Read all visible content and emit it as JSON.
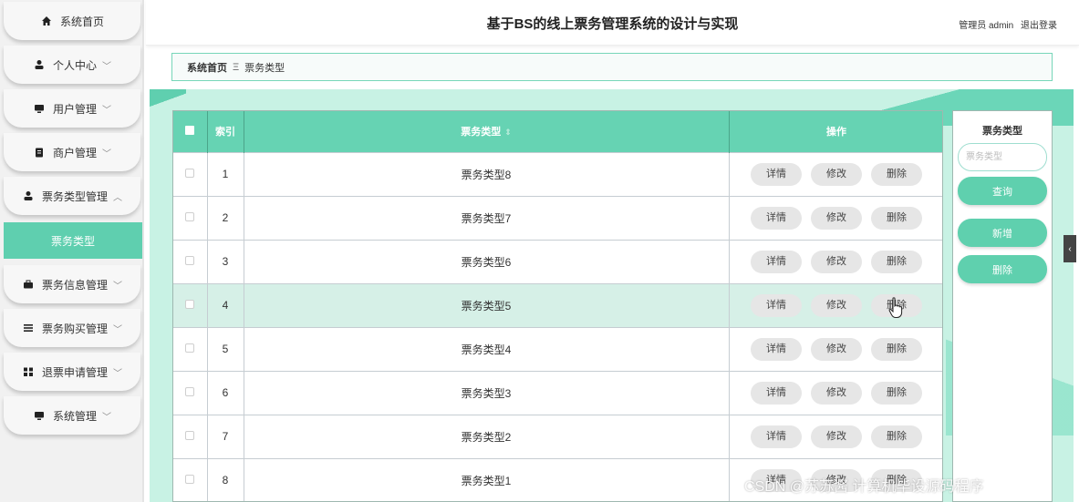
{
  "sidebar": {
    "items": [
      {
        "label": "系统首页",
        "icon": "home-icon",
        "chevron": ""
      },
      {
        "label": "个人中心",
        "icon": "user-icon",
        "chevron": "﹀"
      },
      {
        "label": "用户管理",
        "icon": "monitor-icon",
        "chevron": "﹀"
      },
      {
        "label": "商户管理",
        "icon": "clipboard-icon",
        "chevron": "﹀"
      },
      {
        "label": "票务类型管理",
        "icon": "user-icon",
        "chevron": "︿"
      },
      {
        "label": "票务信息管理",
        "icon": "briefcase-icon",
        "chevron": "﹀"
      },
      {
        "label": "票务购买管理",
        "icon": "list-icon",
        "chevron": "﹀"
      },
      {
        "label": "退票申请管理",
        "icon": "grid-icon",
        "chevron": "﹀"
      },
      {
        "label": "系统管理",
        "icon": "monitor-icon",
        "chevron": "﹀"
      }
    ],
    "active_sub": "票务类型"
  },
  "header": {
    "title": "基于BS的线上票务管理系统的设计与实现",
    "role": "管理员 admin",
    "logout": "退出登录"
  },
  "breadcrumb": {
    "home": "系统首页",
    "separator": "Ξ",
    "current": "票务类型"
  },
  "table": {
    "headers": {
      "index": "索引",
      "type": "票务类型",
      "actions": "操作"
    },
    "rows": [
      {
        "index": "1",
        "type": "票务类型8"
      },
      {
        "index": "2",
        "type": "票务类型7"
      },
      {
        "index": "3",
        "type": "票务类型6"
      },
      {
        "index": "4",
        "type": "票务类型5"
      },
      {
        "index": "5",
        "type": "票务类型4"
      },
      {
        "index": "6",
        "type": "票务类型3"
      },
      {
        "index": "7",
        "type": "票务类型2"
      },
      {
        "index": "8",
        "type": "票务类型1"
      }
    ],
    "highlighted_row": "4",
    "action_labels": {
      "detail": "详情",
      "edit": "修改",
      "delete": "删除"
    }
  },
  "filter": {
    "label": "票务类型",
    "placeholder": "票务类型",
    "search": "查询",
    "add": "新增",
    "delete": "删除"
  },
  "watermark": "CSDN @苏苏酱 计算机毕设源码程序",
  "colors": {
    "accent": "#66d3b3",
    "content_bg": "#c8f2e4",
    "button_gray": "#e6e6e6"
  }
}
